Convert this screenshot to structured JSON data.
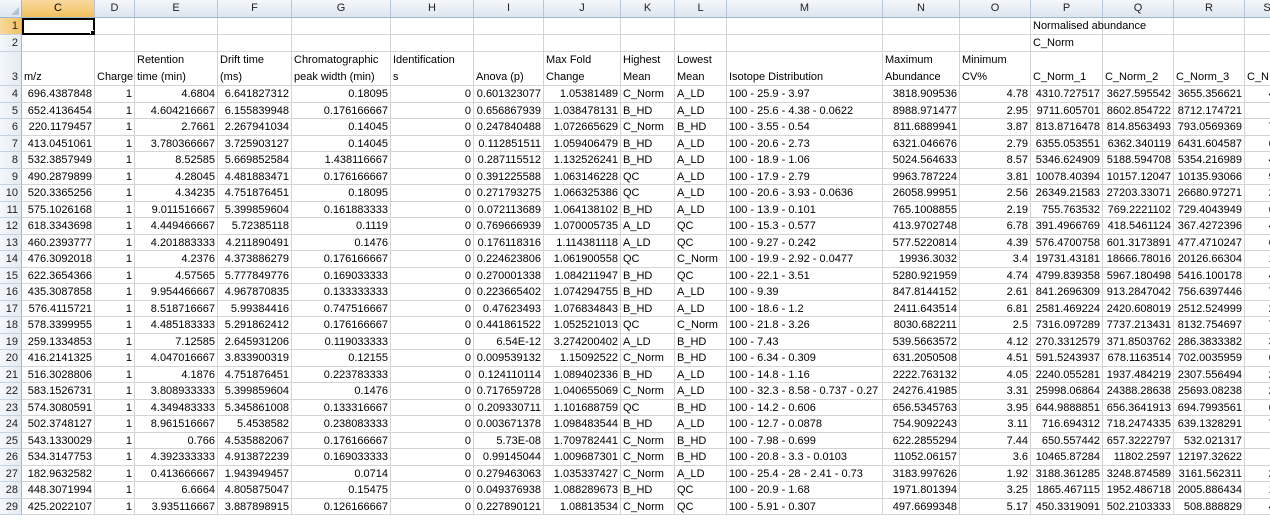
{
  "columns": [
    "C",
    "D",
    "E",
    "F",
    "G",
    "H",
    "I",
    "J",
    "K",
    "L",
    "M",
    "N",
    "O",
    "P",
    "Q",
    "R",
    "S"
  ],
  "active_column": "C",
  "active_row": 1,
  "row1": {
    "P": "Normalised abundance"
  },
  "row2": {
    "P": "C_Norm"
  },
  "header_top": {
    "E": "Retention",
    "F": "Drift time",
    "G": "Chromatographic",
    "H": "Identification",
    "J": "Max Fold",
    "K": "Highest",
    "L": "Lowest",
    "N": "Maximum",
    "O": "Minimum"
  },
  "header_bottom": {
    "C": "m/z",
    "D": "Charge",
    "E": "time (min)",
    "F": "(ms)",
    "G": "peak width (min)",
    "H": "s",
    "I": "Anova (p)",
    "J": "Change",
    "K": "Mean",
    "L": "Mean",
    "M": "Isotope Distribution",
    "N": "Abundance",
    "O": "CV%",
    "P": "C_Norm_1",
    "Q": "C_Norm_2",
    "R": "C_Norm_3",
    "S": "C_N"
  },
  "rows": [
    [
      "696.4387848",
      "1",
      "4.6804",
      "6.641827312",
      "0.18095",
      "0",
      "0.601323077",
      "1.05381489",
      "C_Norm",
      "A_LD",
      "100 - 25.9 - 3.97",
      "3818.909536",
      "4.78",
      "4310.727517",
      "3627.595542",
      "3655.356621",
      "409"
    ],
    [
      "652.4136454",
      "1",
      "4.604216667",
      "6.155839948",
      "0.176166667",
      "0",
      "0.656867939",
      "1.038478131",
      "B_HD",
      "A_LD",
      "100 - 25.6 - 4.38 - 0.0622",
      "8988.971477",
      "2.95",
      "9711.605701",
      "8602.854722",
      "8712.174721",
      "84"
    ],
    [
      "220.1179457",
      "1",
      "2.7661",
      "2.267941034",
      "0.14045",
      "0",
      "0.247840488",
      "1.072665629",
      "C_Norm",
      "B_HD",
      "100 - 3.55 - 0.54",
      "811.6889941",
      "3.87",
      "813.8716478",
      "814.8563493",
      "793.0569369",
      "761"
    ],
    [
      "413.0451061",
      "1",
      "3.780366667",
      "3.725903127",
      "0.14045",
      "0",
      "0.112851511",
      "1.059406479",
      "B_HD",
      "A_LD",
      "100 - 20.6 - 2.73",
      "6321.046676",
      "2.79",
      "6355.053551",
      "6362.340119",
      "6431.604587",
      "609"
    ],
    [
      "532.3857949",
      "1",
      "8.52585",
      "5.669852584",
      "1.438116667",
      "0",
      "0.287115512",
      "1.132526241",
      "B_HD",
      "A_LD",
      "100 - 18.9 - 1.06",
      "5024.564633",
      "8.57",
      "5346.624909",
      "5188.594708",
      "5354.216989",
      "441"
    ],
    [
      "490.2879899",
      "1",
      "4.28045",
      "4.481883471",
      "0.176166667",
      "0",
      "0.391225588",
      "1.063146228",
      "QC",
      "A_LD",
      "100 - 17.9 - 2.79",
      "9963.787224",
      "3.81",
      "10078.40394",
      "10157.12047",
      "10135.93066",
      "958"
    ],
    [
      "520.3365256",
      "1",
      "4.34235",
      "4.751876451",
      "0.18095",
      "0",
      "0.271793275",
      "1.066325386",
      "QC",
      "A_LD",
      "100 - 20.6 - 3.93 - 0.0636",
      "26058.99951",
      "2.56",
      "26349.21583",
      "27203.33071",
      "26680.97271",
      "247"
    ],
    [
      "575.1026168",
      "1",
      "9.011516667",
      "5.399859604",
      "0.161883333",
      "0",
      "0.072113689",
      "1.064138102",
      "B_HD",
      "A_LD",
      "100 - 13.9 - 0.101",
      "765.1008855",
      "2.19",
      "755.763532",
      "769.2221102",
      "729.4043949",
      "694"
    ],
    [
      "618.3343698",
      "1",
      "4.449466667",
      "5.72385118",
      "0.1119",
      "0",
      "0.769666939",
      "1.070005735",
      "A_LD",
      "QC",
      "100 - 15.3 - 0.577",
      "413.9702748",
      "6.78",
      "391.4966769",
      "418.5461124",
      "367.4272396",
      "426"
    ],
    [
      "460.2393777",
      "1",
      "4.201883333",
      "4.211890491",
      "0.1476",
      "0",
      "0.176118316",
      "1.114381118",
      "A_LD",
      "QC",
      "100 - 9.27 - 0.242",
      "577.5220814",
      "4.39",
      "576.4700758",
      "601.3173891",
      "477.4710247",
      "606"
    ],
    [
      "476.3092018",
      "1",
      "4.2376",
      "4.373886279",
      "0.176166667",
      "0",
      "0.224623806",
      "1.061900558",
      "QC",
      "C_Norm",
      "100 - 19.9 - 2.92 - 0.0477",
      "19936.3032",
      "3.4",
      "19731.43181",
      "18666.78016",
      "20126.66304",
      "180"
    ],
    [
      "622.3654366",
      "1",
      "4.57565",
      "5.777849776",
      "0.169033333",
      "0",
      "0.270001338",
      "1.084211947",
      "B_HD",
      "QC",
      "100 - 22.1 - 3.51",
      "5280.921959",
      "4.74",
      "4799.839358",
      "5967.180498",
      "5416.100178",
      "491"
    ],
    [
      "435.3087858",
      "1",
      "9.954466667",
      "4.967870835",
      "0.133333333",
      "0",
      "0.223665402",
      "1.074294755",
      "B_HD",
      "A_LD",
      "100 - 9.39",
      "847.8144152",
      "2.61",
      "841.2696309",
      "913.2847042",
      "756.6397446",
      "782"
    ],
    [
      "576.4115721",
      "1",
      "8.518716667",
      "5.99384416",
      "0.747516667",
      "0",
      "0.47623493",
      "1.076834843",
      "B_HD",
      "A_LD",
      "100 - 18.6 - 1.2",
      "2411.643514",
      "6.81",
      "2581.469224",
      "2420.608019",
      "2512.524999",
      "220"
    ],
    [
      "578.3399955",
      "1",
      "4.485183333",
      "5.291862412",
      "0.176166667",
      "0",
      "0.441861522",
      "1.052521013",
      "QC",
      "C_Norm",
      "100 - 21.8 - 3.26",
      "8030.682211",
      "2.5",
      "7316.097289",
      "7737.213431",
      "8132.754697",
      "785"
    ],
    [
      "259.1334853",
      "1",
      "7.12585",
      "2.645931206",
      "0.119033333",
      "0",
      "6.54E-12",
      "3.274200402",
      "A_LD",
      "B_HD",
      "100 - 7.43",
      "539.5663572",
      "4.12",
      "270.3312579",
      "371.8503762",
      "286.3833382",
      "300"
    ],
    [
      "416.2141325",
      "1",
      "4.047016667",
      "3.833900319",
      "0.12155",
      "0",
      "0.009539132",
      "1.15092522",
      "C_Norm",
      "B_HD",
      "100 - 6.34 - 0.309",
      "631.2050508",
      "4.51",
      "591.5243937",
      "678.1163514",
      "702.0035959",
      "604"
    ],
    [
      "516.3028806",
      "1",
      "4.1876",
      "4.751876451",
      "0.223783333",
      "0",
      "0.124110114",
      "1.089402336",
      "B_HD",
      "A_LD",
      "100 - 14.8 - 1.16",
      "2222.763132",
      "4.05",
      "2240.055281",
      "1937.484219",
      "2307.556494",
      "203"
    ],
    [
      "583.1526731",
      "1",
      "3.808933333",
      "5.399859604",
      "0.1476",
      "0",
      "0.717659728",
      "1.040655069",
      "C_Norm",
      "A_LD",
      "100 - 32.3 - 8.58 - 0.737 - 0.27",
      "24276.41985",
      "3.31",
      "25998.06864",
      "24388.28638",
      "25693.08238",
      "243"
    ],
    [
      "574.3080591",
      "1",
      "4.349483333",
      "5.345861008",
      "0.133316667",
      "0",
      "0.209330711",
      "1.101688759",
      "QC",
      "B_HD",
      "100 - 14.2 - 0.606",
      "656.5345763",
      "3.95",
      "644.9888851",
      "656.3641913",
      "694.7993561",
      "613"
    ],
    [
      "502.3748127",
      "1",
      "8.961516667",
      "5.4538582",
      "0.238083333",
      "0",
      "0.003671378",
      "1.098483544",
      "B_HD",
      "A_LD",
      "100 - 12.7 - 0.0878",
      "754.9092243",
      "3.11",
      "716.694312",
      "718.2474335",
      "639.1328291",
      "704"
    ],
    [
      "543.1330029",
      "1",
      "0.766",
      "4.535882067",
      "0.176166667",
      "0",
      "5.73E-08",
      "1.709782441",
      "C_Norm",
      "B_HD",
      "100 - 7.98 - 0.699",
      "622.2855294",
      "7.44",
      "650.557442",
      "657.3222797",
      "532.021317",
      "61"
    ],
    [
      "534.3147753",
      "1",
      "4.392333333",
      "4.913872239",
      "0.169033333",
      "0",
      "0.99145044",
      "1.009687301",
      "C_Norm",
      "B_HD",
      "100 - 20.8 - 3.3 - 0.0103",
      "11052.06157",
      "3.6",
      "10465.87284",
      "11802.2597",
      "12197.32622",
      "111"
    ],
    [
      "182.9632582",
      "1",
      "0.413666667",
      "1.943949457",
      "0.0714",
      "0",
      "0.279463063",
      "1.035337427",
      "C_Norm",
      "A_LD",
      "100 - 25.4 - 28 - 2.41 - 0.73",
      "3183.997626",
      "1.92",
      "3188.361285",
      "3248.874589",
      "3161.562311",
      "298"
    ],
    [
      "448.3071994",
      "1",
      "6.6664",
      "4.805875047",
      "0.15475",
      "0",
      "0.049376938",
      "1.088289673",
      "B_HD",
      "QC",
      "100 - 20.9 - 1.68",
      "1971.801394",
      "3.25",
      "1865.467115",
      "1952.486718",
      "2005.886434",
      "188"
    ],
    [
      "425.2022107",
      "1",
      "3.935116667",
      "3.887898915",
      "0.126166667",
      "0",
      "0.227890121",
      "1.08813534",
      "C_Norm",
      "QC",
      "100 - 5.91 - 0.307",
      "497.6699348",
      "5.17",
      "450.3319091",
      "502.2103333",
      "508.888829",
      "448"
    ]
  ]
}
